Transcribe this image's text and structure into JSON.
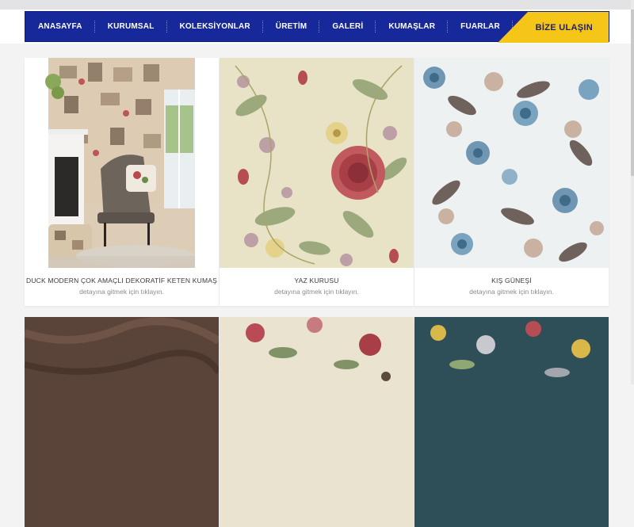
{
  "nav": {
    "items": [
      "ANASAYFA",
      "KURUMSAL",
      "KOLEKSİYONLAR",
      "ÜRETİM",
      "GALERİ",
      "KUMAŞLAR",
      "FUARLAR"
    ],
    "cta": "BİZE ULAŞIN"
  },
  "products": [
    {
      "title": "DUCK MODERN ÇOK AMAÇLI DEKORATİF KETEN KUMAŞ",
      "subtitle": "detayına gitmek için tıklayın."
    },
    {
      "title": "YAZ KURUSU",
      "subtitle": "detayına gitmek için tıklayın."
    },
    {
      "title": "KIŞ GÜNEŞİ",
      "subtitle": "detayına gitmek için tıklayın."
    }
  ],
  "colors": {
    "nav_bg": "#17289a",
    "cta_bg": "#f5c518",
    "page_bg": "#f3f3f4"
  }
}
